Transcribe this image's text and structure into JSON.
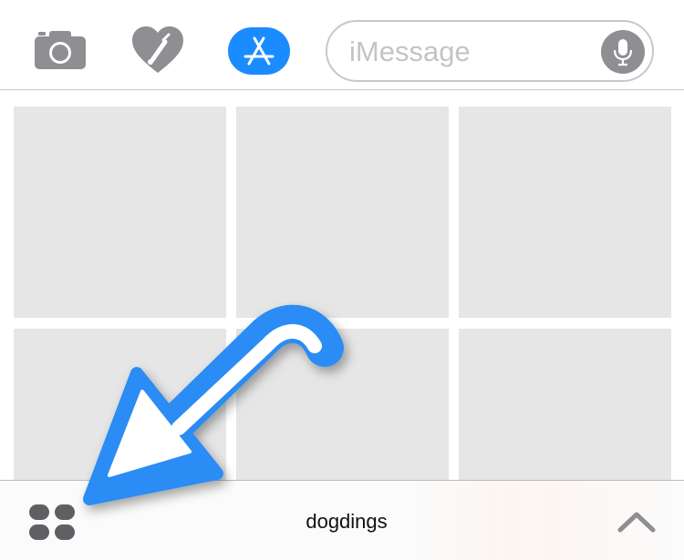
{
  "toolbar": {
    "camera_icon": "camera-icon",
    "heart_icon": "digital-touch-heart-icon",
    "store_icon": "app-store-icon",
    "accent_color": "#1a8cff"
  },
  "message_field": {
    "placeholder": "iMessage",
    "value": "",
    "mic_icon": "microphone-icon"
  },
  "sticker_grid": {
    "tile_color": "#e6e6e6",
    "rows": 2,
    "columns": 3
  },
  "drawer": {
    "app_name": "dogdings",
    "apps_icon": "app-drawer-icon",
    "expand_icon": "chevron-up-icon"
  },
  "annotation": {
    "arrow_color": "#2a8cf4",
    "arrow_icon": "pointer-arrow-icon"
  }
}
